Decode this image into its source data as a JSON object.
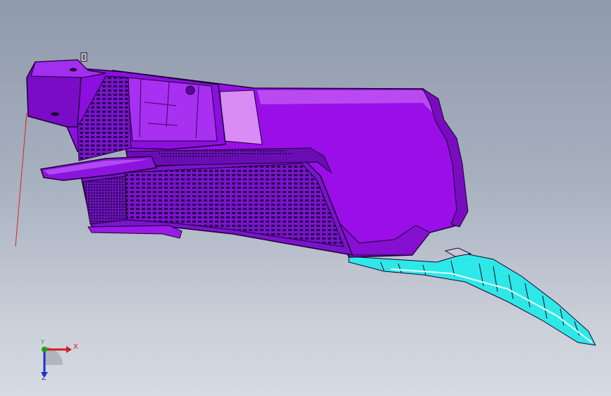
{
  "viewport": {
    "background_top": "#8f9aac",
    "background_bottom": "#d7dbe2"
  },
  "model": {
    "primary_color": "#9a0fe8",
    "dark_color": "#5a0696",
    "light_color": "#d88cf4",
    "edge_color": "#1a0030",
    "accent_color": "#2ee8e8"
  },
  "triad": {
    "x_label": "X",
    "y_label": "Y",
    "z_label": "Z",
    "x_color": "#d42020",
    "y_color": "#1aa01a",
    "z_color": "#2030c8"
  }
}
